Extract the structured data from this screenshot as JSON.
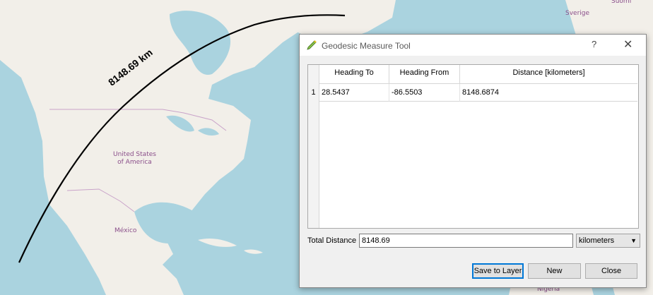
{
  "map": {
    "labels": {
      "united_states": "United States\nof America",
      "mexico": "México",
      "sverige": "Sverige",
      "suomi": "Suomi",
      "nigeria": "Nigeria"
    },
    "measurement_label": "8148.69 km",
    "colors": {
      "water": "#aad3df",
      "land": "#f2efe9",
      "line": "#000000",
      "border": "#c9a3c9"
    }
  },
  "dialog": {
    "title": "Geodesic Measure Tool",
    "help_glyph": "?",
    "close_glyph": "✕",
    "table": {
      "headers": [
        "Heading To",
        "Heading From",
        "Distance [kilometers]"
      ],
      "rows": [
        {
          "num": "1",
          "heading_to": "28.5437",
          "heading_from": "-86.5503",
          "distance": "8148.6874"
        }
      ]
    },
    "total_distance_label": "Total Distance",
    "total_distance_value": "8148.69",
    "units_selected": "kilometers",
    "buttons": {
      "save": "Save to Layer",
      "new": "New",
      "close": "Close"
    }
  }
}
